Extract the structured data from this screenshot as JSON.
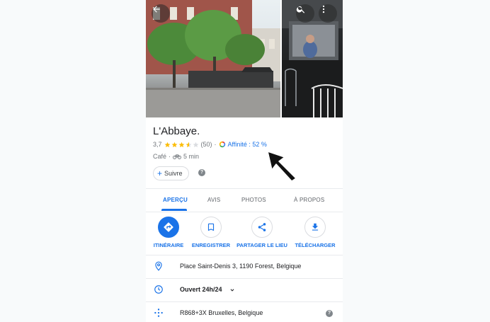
{
  "photo_actions": {
    "back_icon": "arrow-left-icon",
    "search_icon": "search-icon",
    "more_icon": "more-vert-icon"
  },
  "place": {
    "name": "L'Abbaye.",
    "rating": "3,7",
    "rating_value": 3.7,
    "review_count": "(50)",
    "affinity": "Affinité : 52 %",
    "category": "Café",
    "separator": "·",
    "travel_time": "5 min"
  },
  "follow": {
    "label": "Suivre"
  },
  "tabs": [
    {
      "label": "APERÇU",
      "active": true
    },
    {
      "label": "AVIS",
      "active": false
    },
    {
      "label": "PHOTOS",
      "active": false
    },
    {
      "label": "À PROPOS",
      "active": false
    }
  ],
  "actions": [
    {
      "label": "ITINÉRAIRE",
      "icon": "directions-icon"
    },
    {
      "label": "ENREGISTRER",
      "icon": "bookmark-icon"
    },
    {
      "label": "PARTAGER LE LIEU",
      "icon": "share-icon"
    },
    {
      "label": "TÉLÉCHARGER",
      "icon": "download-icon"
    }
  ],
  "info": {
    "address": "Place Saint-Denis 3, 1190 Forest, Belgique",
    "hours": "Ouvert 24h/24",
    "plus_code": "R868+3X Bruxelles, Belgique"
  },
  "colors": {
    "accent": "#1a73e8",
    "star": "#fbbc04",
    "text_secondary": "#70757a"
  }
}
